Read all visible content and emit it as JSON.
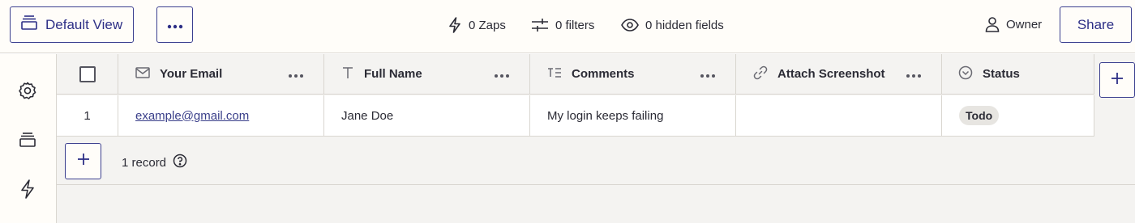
{
  "toolbar": {
    "view_label": "Default View",
    "zaps_label": "0 Zaps",
    "filters_label": "0 filters",
    "hidden_fields_label": "0 hidden fields",
    "owner_label": "Owner",
    "share_label": "Share"
  },
  "sidebar": {
    "items": [
      {
        "icon": "gear-icon"
      },
      {
        "icon": "views-icon"
      },
      {
        "icon": "zap-icon"
      }
    ]
  },
  "table": {
    "columns": [
      {
        "label": "Your Email",
        "icon": "mail-icon"
      },
      {
        "label": "Full Name",
        "icon": "text-icon"
      },
      {
        "label": "Comments",
        "icon": "long-text-icon"
      },
      {
        "label": "Attach Screenshot",
        "icon": "link-icon"
      },
      {
        "label": "Status",
        "icon": "dropdown-circle-icon"
      }
    ],
    "rows": [
      {
        "number": "1",
        "email": "example@gmail.com",
        "full_name": "Jane Doe",
        "comments": "My login keeps failing",
        "attach_screenshot": "",
        "status": "Todo"
      }
    ],
    "record_count": "1 record"
  },
  "colors": {
    "accent": "#2d2f86",
    "border": "#d9d6d0",
    "grid_bg": "#f4f3f1",
    "badge_bg": "#e7e5e1"
  }
}
